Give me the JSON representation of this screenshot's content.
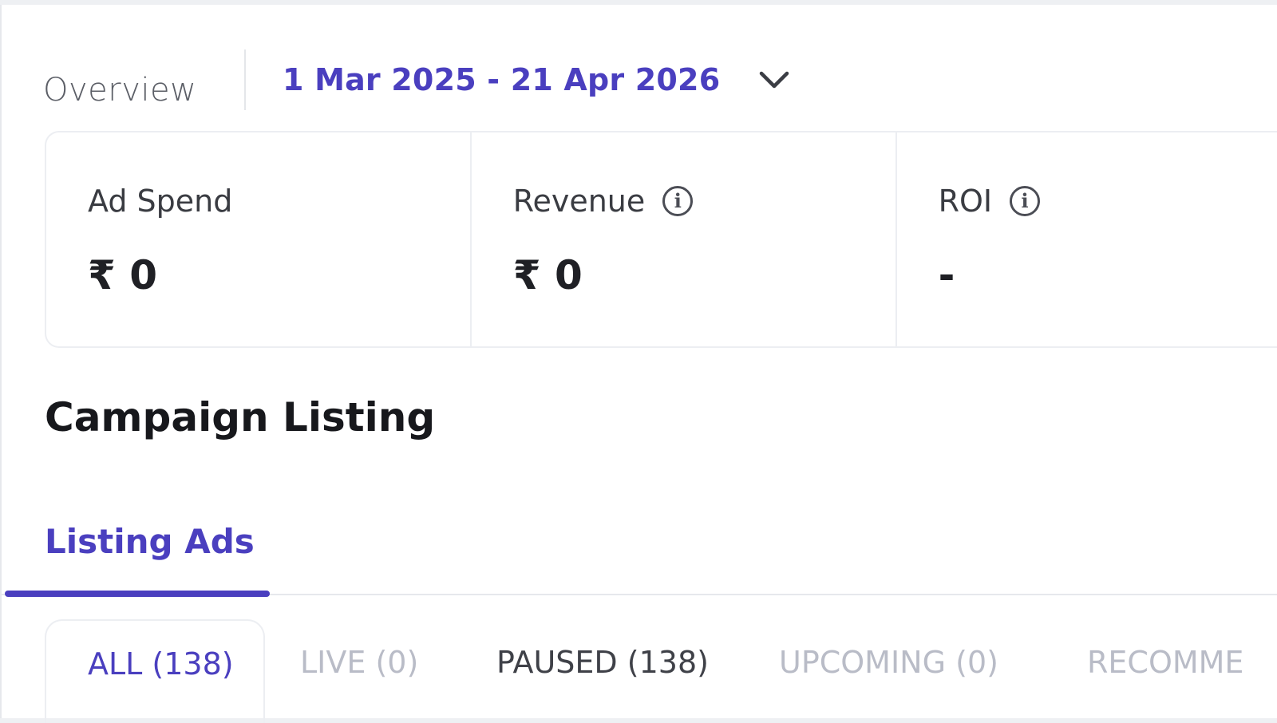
{
  "overview": {
    "label": "Overview",
    "date_range": "1 Mar 2025 - 21 Apr 2026",
    "dropdown_icon": "chevron-down-icon"
  },
  "metrics": [
    {
      "label": "Ad Spend",
      "value": "₹ 0",
      "info": false
    },
    {
      "label": "Revenue",
      "value": "₹ 0",
      "info": true,
      "info_icon": "info-icon"
    },
    {
      "label": "ROI",
      "value": "-",
      "info": true,
      "info_icon": "info-icon"
    }
  ],
  "campaign": {
    "title": "Campaign Listing",
    "tabs": [
      {
        "label": "Listing Ads",
        "active": true
      }
    ],
    "status_tabs": [
      {
        "label": "ALL (138)",
        "state": "active"
      },
      {
        "label": "LIVE (0)",
        "state": "disabled"
      },
      {
        "label": "PAUSED (138)",
        "state": "normal"
      },
      {
        "label": "UPCOMING (0)",
        "state": "disabled"
      },
      {
        "label": "RECOMME",
        "state": "disabled"
      }
    ]
  },
  "colors": {
    "accent": "#4a3fbf",
    "muted": "#b9bcc7",
    "text": "#17181c"
  }
}
